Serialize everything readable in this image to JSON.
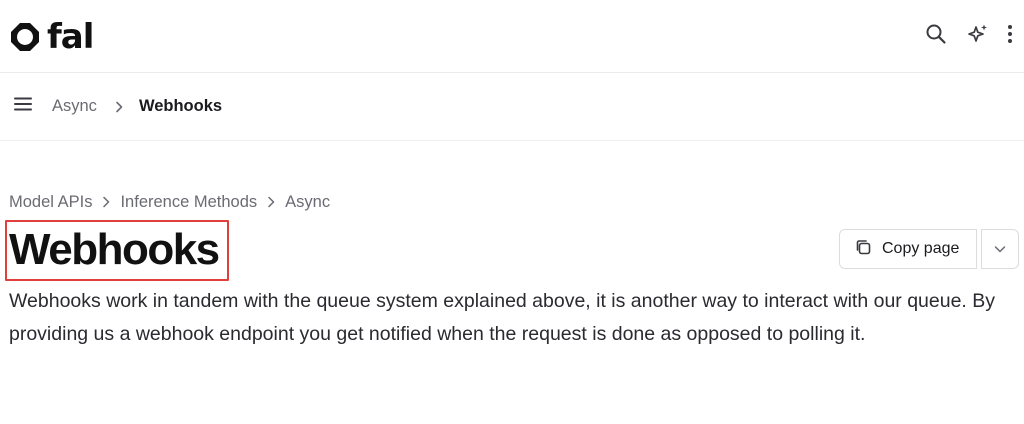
{
  "header": {
    "brand": "fal",
    "icons": {
      "logo": "fal-logo-icon",
      "search": "search-icon",
      "ai": "sparkles-icon",
      "more": "more-vertical-icon"
    }
  },
  "subnav": {
    "parent": "Async",
    "current": "Webhooks",
    "icons": {
      "menu": "menu-icon",
      "separator": "chevron-right-icon"
    }
  },
  "breadcrumb": {
    "items": [
      "Model APIs",
      "Inference Methods",
      "Async"
    ]
  },
  "page": {
    "title": "Webhooks",
    "highlight_color": "#e0403c",
    "body": "Webhooks work in tandem with the queue system explained above, it is another way to interact with our queue. By providing us a webhook endpoint you get notified when the request is done as opposed to polling it."
  },
  "actions": {
    "copy_label": "Copy page",
    "icons": {
      "copy": "copy-icon",
      "dropdown": "chevron-down-icon"
    }
  }
}
